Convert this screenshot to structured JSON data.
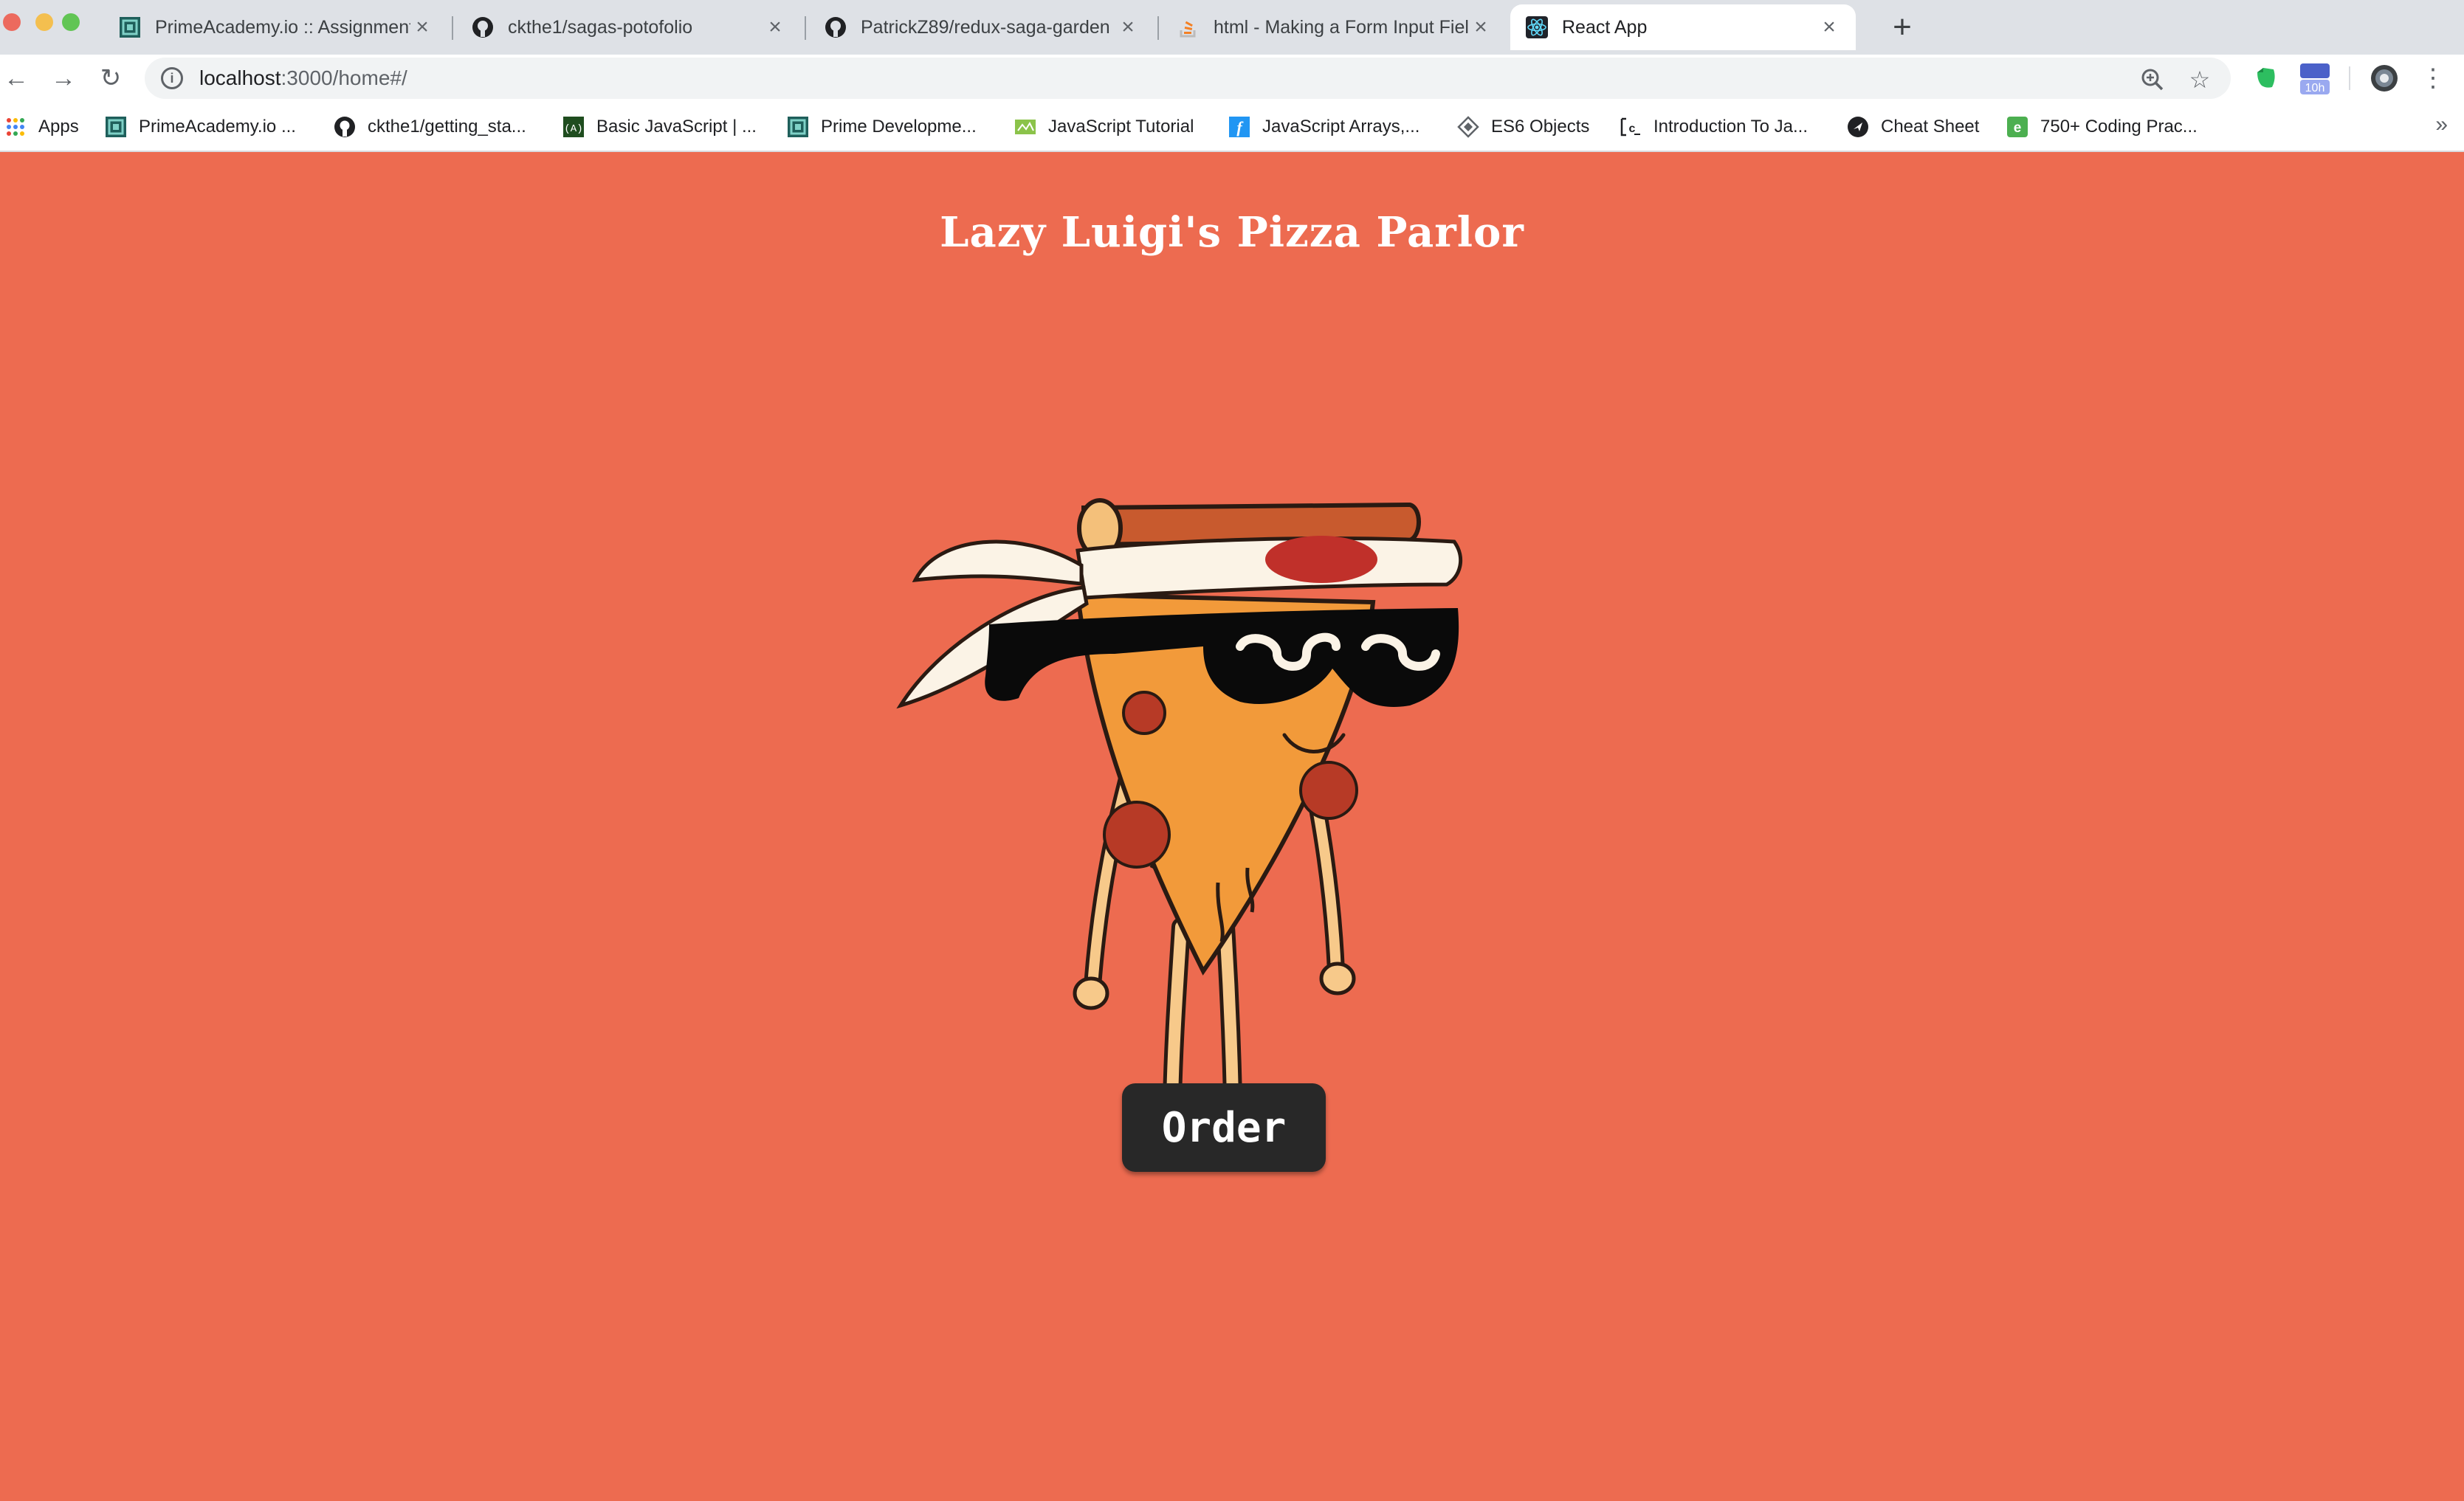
{
  "browser": {
    "tabs": [
      {
        "title": "PrimeAcademy.io :: Assignments",
        "favicon": "prime-academy-icon",
        "active": false
      },
      {
        "title": "ckthe1/sagas-potofolio",
        "favicon": "github-icon",
        "active": false
      },
      {
        "title": "PatrickZ89/redux-saga-garden",
        "favicon": "github-icon",
        "active": false
      },
      {
        "title": "html - Making a Form Input Field",
        "favicon": "stackoverflow-icon",
        "active": false
      },
      {
        "title": "React App",
        "favicon": "react-icon",
        "active": true
      }
    ],
    "address": {
      "host": "localhost",
      "path": ":3000/home#/"
    },
    "extensions": {
      "badge": "10h"
    },
    "bookmarks": [
      {
        "label": "Apps",
        "icon": "apps-grid-icon"
      },
      {
        "label": "PrimeAcademy.io ...",
        "icon": "prime-academy-icon"
      },
      {
        "label": "ckthe1/getting_sta...",
        "icon": "github-icon"
      },
      {
        "label": "Basic JavaScript | ...",
        "icon": "code-icon"
      },
      {
        "label": "Prime Developme...",
        "icon": "prime-academy-icon"
      },
      {
        "label": "JavaScript Tutorial",
        "icon": "tutorial-icon"
      },
      {
        "label": "JavaScript Arrays,...",
        "icon": "f-icon"
      },
      {
        "label": "ES6 Objects",
        "icon": "diamond-icon"
      },
      {
        "label": "Introduction To Ja...",
        "icon": "c-icon"
      },
      {
        "label": "Cheat Sheet",
        "icon": "cheat-sheet-icon"
      },
      {
        "label": "750+ Coding Prac...",
        "icon": "e-icon"
      }
    ]
  },
  "colors": {
    "page_background": "#ED6B50",
    "button_background": "#282828",
    "heading_text": "#FFFFFF"
  },
  "page": {
    "heading": "Lazy Luigi's Pizza Parlor",
    "mascot": "pizza-slice-mascot",
    "order_button": "Order"
  }
}
